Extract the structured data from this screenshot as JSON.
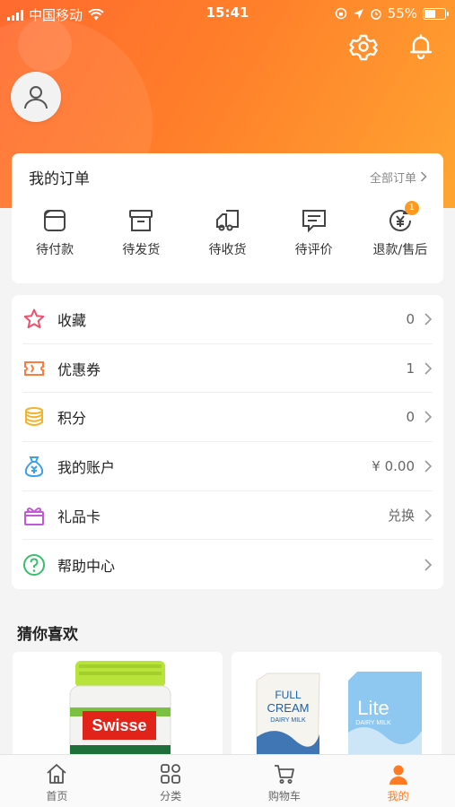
{
  "status_bar": {
    "carrier": "中国移动",
    "time": "15:41",
    "battery": "55%"
  },
  "orders": {
    "title": "我的订单",
    "view_all": "全部订单",
    "items": [
      {
        "label": "待付款",
        "icon": "wallet-icon"
      },
      {
        "label": "待发货",
        "icon": "box-icon"
      },
      {
        "label": "待收货",
        "icon": "truck-icon"
      },
      {
        "label": "待评价",
        "icon": "comment-icon"
      },
      {
        "label": "退款/售后",
        "icon": "refund-icon",
        "badge": "1"
      }
    ]
  },
  "menu": [
    {
      "label": "收藏",
      "value": "0",
      "icon": "star-icon",
      "color": "#f0506e"
    },
    {
      "label": "优惠券",
      "value": "1",
      "icon": "coupon-icon",
      "color": "#ff7a3d"
    },
    {
      "label": "积分",
      "value": "0",
      "icon": "coins-icon",
      "color": "#f4b32b"
    },
    {
      "label": "我的账户",
      "value": "¥ 0.00",
      "icon": "money-bag-icon",
      "color": "#3aa0e8"
    },
    {
      "label": "礼品卡",
      "value": "兑换",
      "icon": "gift-card-icon",
      "color": "#c25ad8"
    },
    {
      "label": "帮助中心",
      "value": "",
      "icon": "help-icon",
      "color": "#37c06a"
    }
  ],
  "recommend": {
    "title": "猜你喜欢",
    "products": [
      {
        "brand": "Swisse"
      },
      {
        "text1": "FULL",
        "text2": "CREAM",
        "text3": "DAIRY MILK",
        "text4": "Lite",
        "text5": "DAIRY MILK"
      }
    ]
  },
  "tabbar": [
    {
      "label": "首页",
      "icon": "home-icon"
    },
    {
      "label": "分类",
      "icon": "category-icon"
    },
    {
      "label": "购物车",
      "icon": "cart-icon"
    },
    {
      "label": "我的",
      "icon": "profile-icon",
      "active": true
    }
  ],
  "colors": {
    "accent": "#ff7a22",
    "header_start": "#ff6a2e",
    "header_end": "#ffa531"
  }
}
